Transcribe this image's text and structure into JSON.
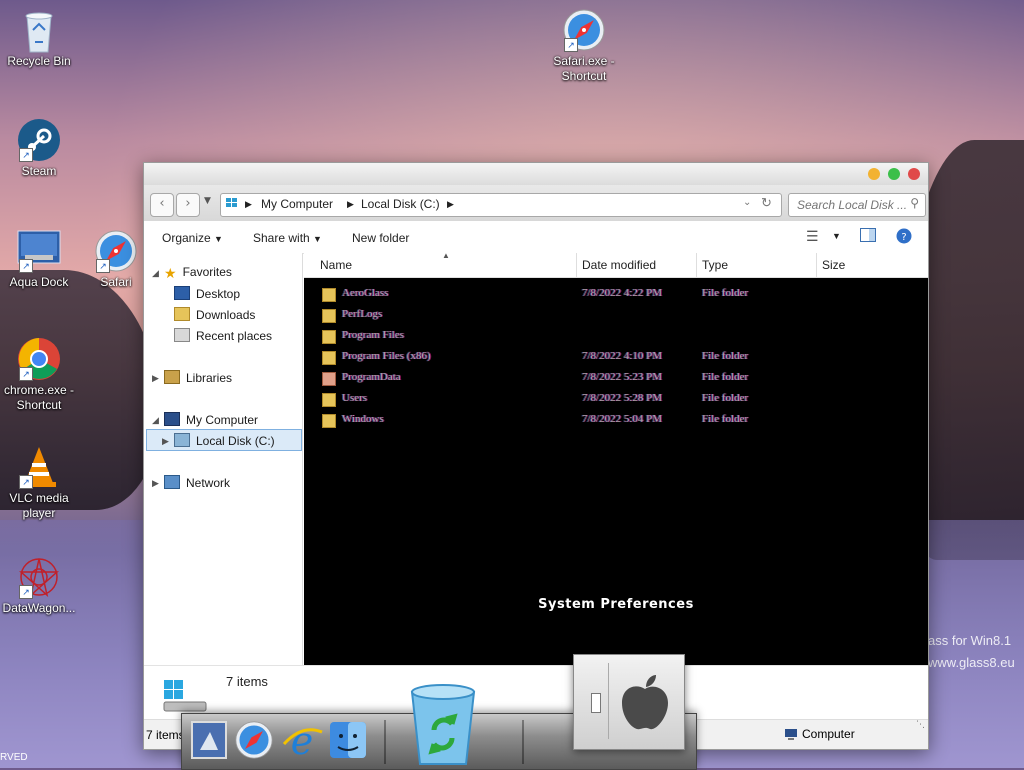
{
  "desktop": {
    "icons": [
      {
        "label": "Recycle Bin",
        "icon": "recycle-bin-icon"
      },
      {
        "label": "Steam",
        "icon": "steam-icon"
      },
      {
        "label": "Aqua Dock",
        "icon": "aqua-dock-icon"
      },
      {
        "label": "Safari",
        "icon": "safari-icon"
      },
      {
        "label": "chrome.exe - Shortcut",
        "icon": "chrome-icon"
      },
      {
        "label": "VLC media player",
        "icon": "vlc-icon"
      },
      {
        "label": "DataWagon...",
        "icon": "datawagon-icon"
      },
      {
        "label": "Safari.exe - Shortcut",
        "icon": "safari-icon"
      }
    ],
    "watermark_line1": "ass for Win8.1",
    "watermark_line2": "www.glass8.eu",
    "corner_text": "RVED"
  },
  "window": {
    "address": {
      "crumbs": [
        "My Computer",
        "Local Disk (C:)"
      ]
    },
    "search": {
      "placeholder": "Search Local Disk ..."
    },
    "toolbar": {
      "organize": "Organize",
      "share_with": "Share with",
      "new_folder": "New folder"
    },
    "nav": {
      "favorites": "Favorites",
      "desktop": "Desktop",
      "downloads": "Downloads",
      "recent_places": "Recent places",
      "libraries": "Libraries",
      "my_computer": "My Computer",
      "local_disk": "Local Disk (C:)",
      "network": "Network"
    },
    "columns": {
      "name": "Name",
      "date_modified": "Date modified",
      "type": "Type",
      "size": "Size"
    },
    "files": [
      {
        "name": "AeroGlass",
        "date": "7/8/2022 4:22 PM",
        "type": "File folder"
      },
      {
        "name": "PerfLogs",
        "date": "",
        "type": ""
      },
      {
        "name": "Program Files",
        "date": "",
        "type": ""
      },
      {
        "name": "Program Files (x86)",
        "date": "7/8/2022 4:10 PM",
        "type": "File folder"
      },
      {
        "name": "ProgramData",
        "date": "7/8/2022 5:23 PM",
        "type": "File folder"
      },
      {
        "name": "Users",
        "date": "7/8/2022 5:28 PM",
        "type": "File folder"
      },
      {
        "name": "Windows",
        "date": "7/8/2022 5:04 PM",
        "type": "File folder"
      }
    ],
    "overlay_label": "System Preferences",
    "details": {
      "count": "7 items"
    },
    "status": {
      "left": "7 items",
      "right": "Computer"
    }
  },
  "colors": {
    "close": "#e04a4a",
    "minimize": "#f2b232",
    "maximize": "#3cbf4a",
    "selection": "#dbeaf8"
  }
}
